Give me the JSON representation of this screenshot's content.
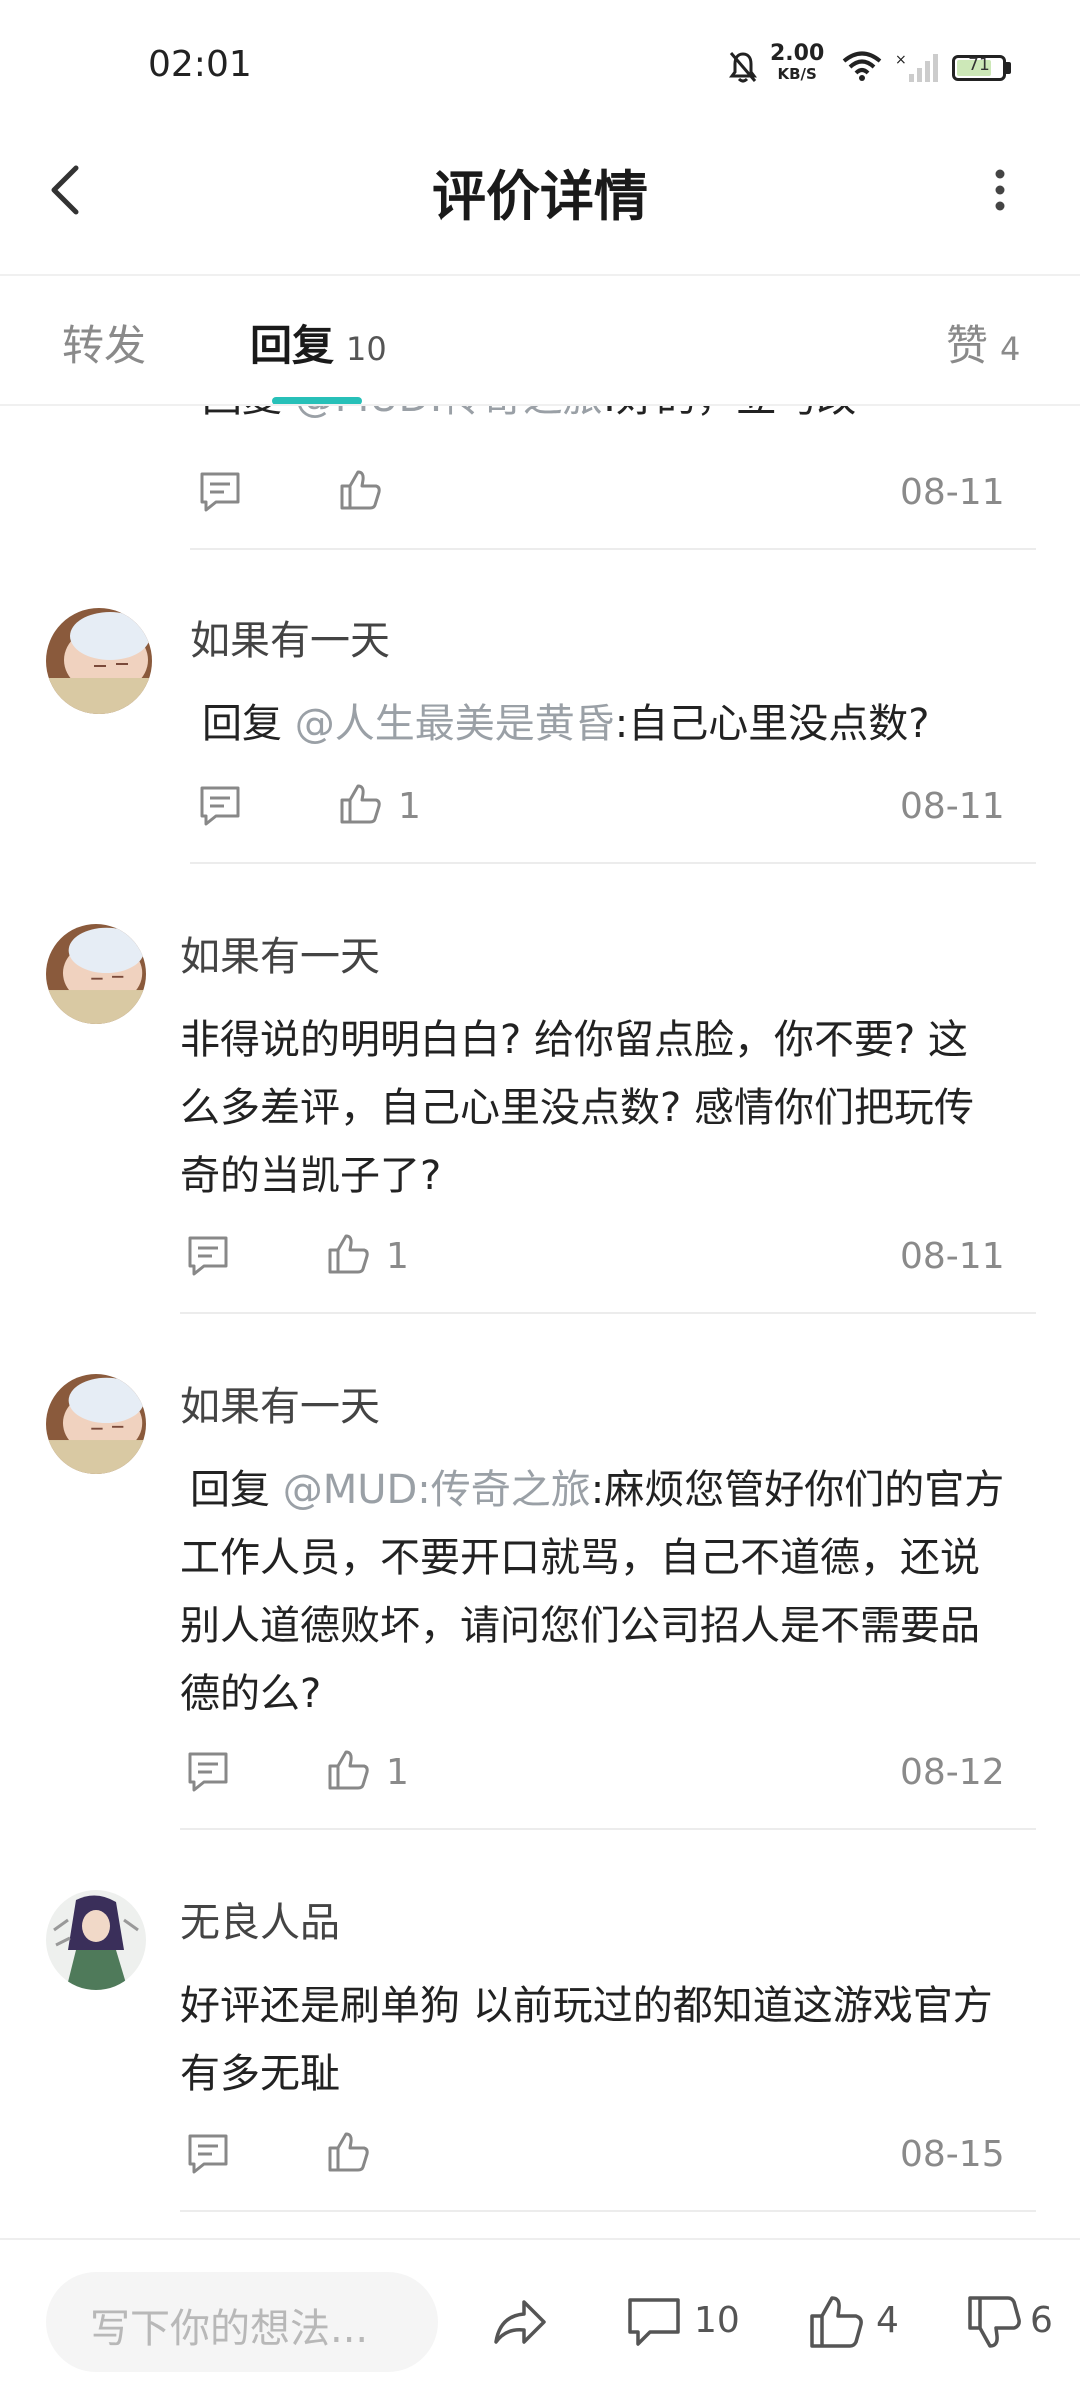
{
  "status": {
    "time": "02:01",
    "net_speed_value": "2.00",
    "net_speed_unit": "KB/S",
    "battery": "71"
  },
  "header": {
    "title": "评价详情"
  },
  "tabs": [
    {
      "label": "转发",
      "count": ""
    },
    {
      "label": "回复",
      "count": "10"
    },
    {
      "label": "赞",
      "count": "4"
    }
  ],
  "comments": [
    {
      "author": "",
      "reply_prefix": "回复 ",
      "mention": "@MUD:传奇之旅",
      "text": ":好的，立马改",
      "likes": "",
      "date": "08-11"
    },
    {
      "author": "如果有一天",
      "reply_prefix": "回复 ",
      "mention": "@人生最美是黄昏",
      "text": ":自己心里没点数?",
      "likes": "1",
      "date": "08-11"
    },
    {
      "author": "如果有一天",
      "reply_prefix": "",
      "mention": "",
      "text_lines": [
        "非得说的明明白白? 给你留点脸，你不要? 这",
        "么多差评，自己心里没点数? 感情你们把玩传",
        "奇的当凯子了?"
      ],
      "likes": "1",
      "date": "08-11"
    },
    {
      "author": "如果有一天",
      "reply_prefix": "回复 ",
      "mention": "@MUD:传奇之旅",
      "text_first": ":麻烦您管好你们的官方",
      "text_lines": [
        "工作人员，不要开口就骂，自己不道德，还说",
        "别人道德败坏，请问您们公司招人是不需要品",
        "德的么?"
      ],
      "likes": "1",
      "date": "08-12"
    },
    {
      "author": "无良人品",
      "reply_prefix": "",
      "mention": "",
      "text_lines": [
        "好评还是刷单狗 以前玩过的都知道这游戏官方",
        "有多无耻"
      ],
      "likes": "",
      "date": "08-15"
    }
  ],
  "bottom": {
    "placeholder": "写下你的想法...",
    "comment_count": "10",
    "like_count": "4",
    "dislike_count": "6"
  },
  "colors": {
    "accent": "#27c0b8",
    "mention": "#9aa0a6"
  },
  "icons": [
    "back-icon",
    "more-icon",
    "comment-icon",
    "thumb-up-icon",
    "share-icon",
    "thumb-down-icon"
  ]
}
